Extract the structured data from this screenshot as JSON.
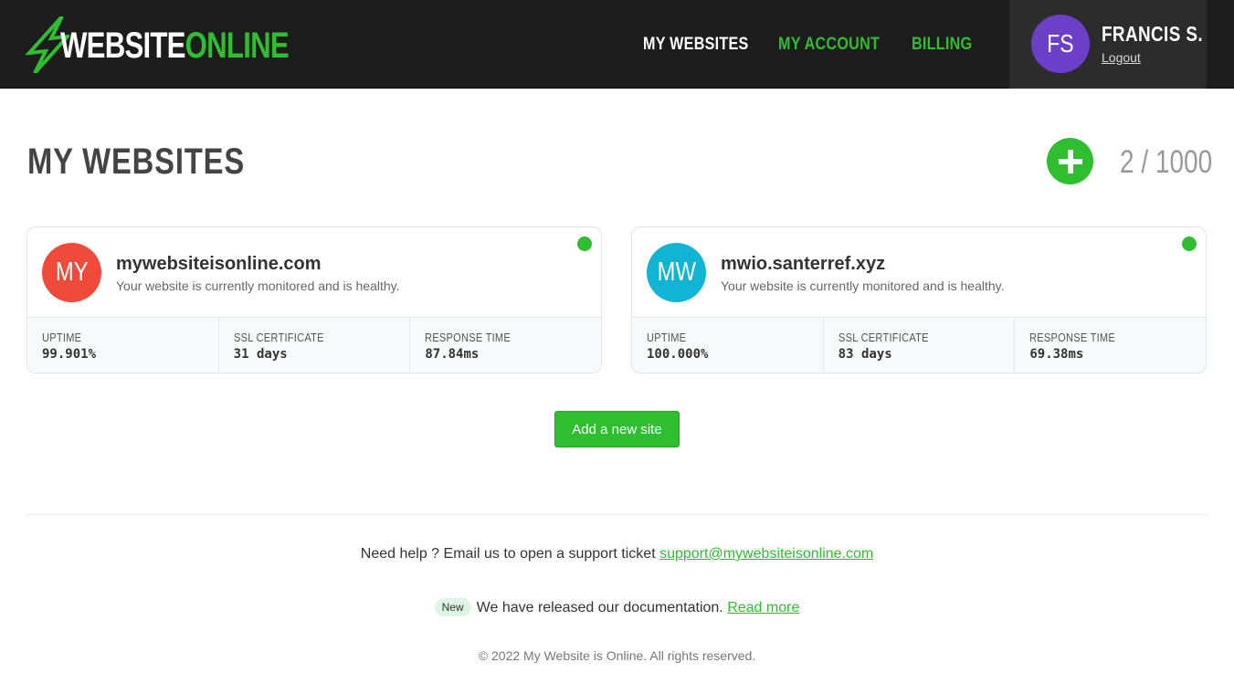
{
  "header": {
    "logo": {
      "word1": "WEBSITE",
      "word2": "ONLINE",
      "icon": "lightning-bolt-icon"
    },
    "nav": [
      {
        "label": "MY WEBSITES"
      },
      {
        "label": "MY ACCOUNT"
      },
      {
        "label": "BILLING"
      }
    ],
    "user": {
      "initials": "FS",
      "name": "FRANCIS S.",
      "logout": "Logout"
    }
  },
  "main": {
    "title": "MY WEBSITES",
    "add_icon": "plus-icon",
    "counter": "2 / 1000",
    "sites": [
      {
        "initials": "MY",
        "avatar_color": "#f04a3a",
        "domain": "mywebsiteisonline.com",
        "status_text": "Your website is currently monitored and is healthy.",
        "status_color": "#2fbe2f",
        "stats": [
          {
            "label": "UPTIME",
            "value": "99.901%"
          },
          {
            "label": "SSL CERTIFICATE",
            "value": "31 days"
          },
          {
            "label": "RESPONSE TIME",
            "value": "87.84ms"
          }
        ]
      },
      {
        "initials": "MW",
        "avatar_color": "#12b4d3",
        "domain": "mwio.santerref.xyz",
        "status_text": "Your website is currently monitored and is healthy.",
        "status_color": "#2fbe2f",
        "stats": [
          {
            "label": "UPTIME",
            "value": "100.000%"
          },
          {
            "label": "SSL CERTIFICATE",
            "value": "83 days"
          },
          {
            "label": "RESPONSE TIME",
            "value": "69.38ms"
          }
        ]
      }
    ],
    "add_site_label": "Add a new site"
  },
  "footer": {
    "help_text": "Need help ? Email us to open a support ticket",
    "help_email": "support@mywebsiteisonline.com",
    "news_badge": "New",
    "news_text": "We have released our documentation.",
    "news_link": "Read more",
    "copyright": "© 2022 My Website is Online. All rights reserved."
  },
  "colors": {
    "accent": "#2fbe2f",
    "header_bg": "#1c1c1c",
    "user_avatar": "#6b3fc7"
  }
}
